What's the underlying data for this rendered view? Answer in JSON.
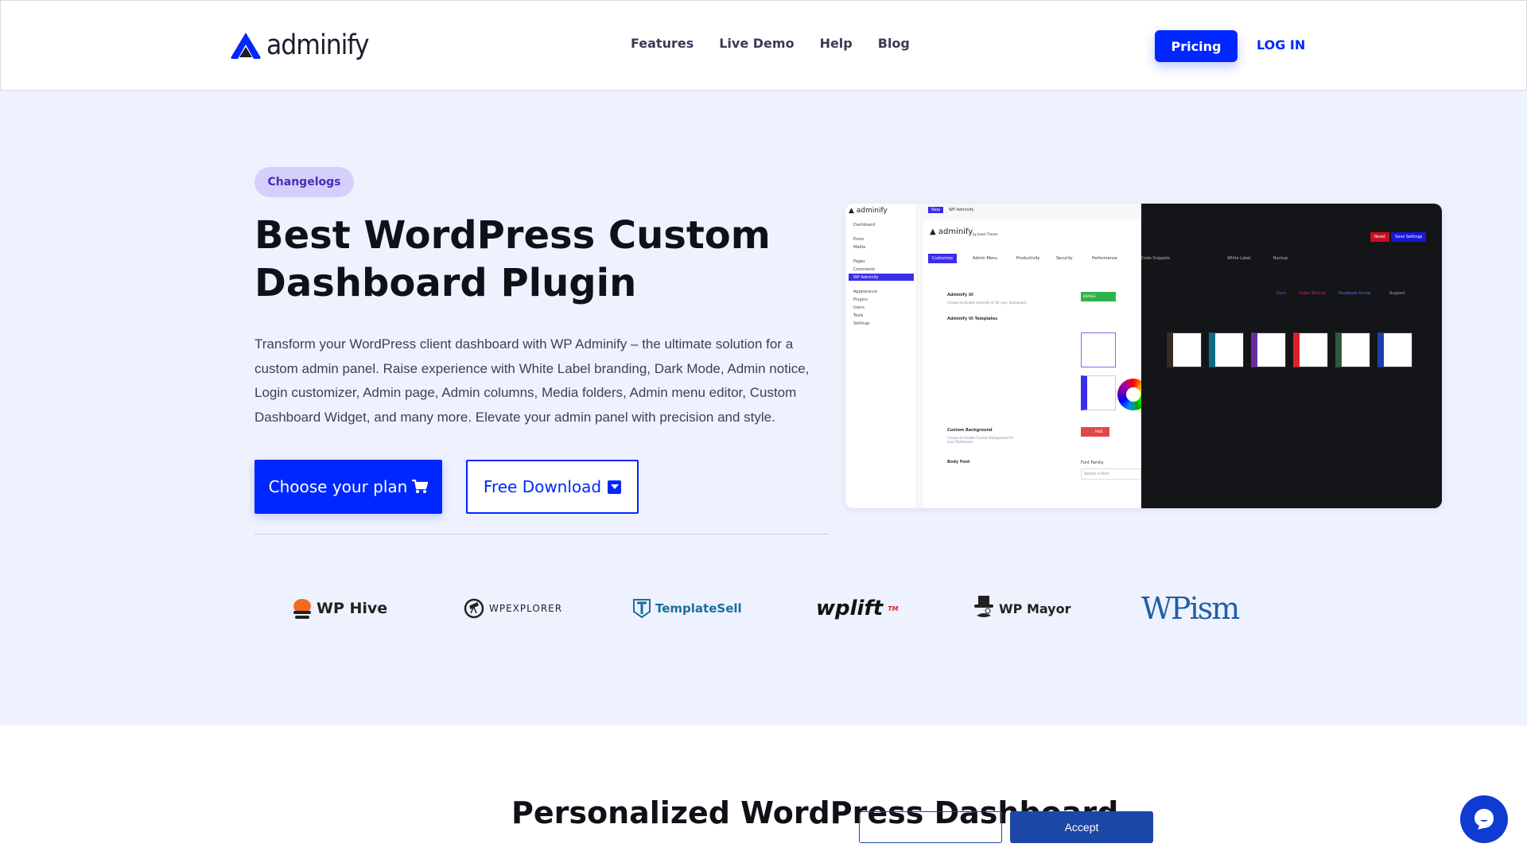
{
  "header": {
    "logo_text": "adminify",
    "nav": [
      "Features",
      "Live Demo",
      "Help",
      "Blog"
    ],
    "pricing_label": "Pricing",
    "login_label": "LOG IN"
  },
  "hero": {
    "badge": "Changelogs",
    "title": "Best WordPress Custom Dashboard Plugin",
    "description": "Transform your WordPress client dashboard with WP Adminify – the ultimate solution for a custom admin panel. Raise experience with White Label branding, Dark Mode, Admin notice, Login customizer, Admin page, Admin columns, Media folders, Admin menu editor, Custom Dashboard Widget, and many more. Elevate your admin panel with precision and style.",
    "primary_button": "Choose your plan",
    "secondary_button": "Free Download",
    "accent_color": "#0027ff"
  },
  "preview": {
    "sidebar": [
      "Dashboard",
      "Posts",
      "Media",
      "Pages",
      "Comments",
      "WP Adminify",
      "Appearance",
      "Plugins",
      "Users",
      "Tools",
      "Settings"
    ],
    "topbar_new": "New",
    "topbar_site": "WP Adminify",
    "brand_by": "by Jewel Theme",
    "tabs": [
      "Customize",
      "Admin Menu",
      "Productivity",
      "Security",
      "Performance",
      "Code Snippets",
      "White Label",
      "Backup"
    ],
    "reset": "Reset",
    "save": "Save Settings",
    "links": [
      "Docs",
      "Video Tutorial",
      "Facebook Group",
      "Support"
    ],
    "ui_label": "Adminify UI",
    "ui_desc": "Choose to Enable Adminify UI for your Dashboard.",
    "ui_toggle": "ENABLE",
    "templates_label": "Adminify UI Templates",
    "bg_label": "Custom Background",
    "bg_desc": "Choose to Enable Custom Background for your Dashboard.",
    "bg_toggle": "HIDE",
    "font_label": "Body Font",
    "font_family_label": "Font Family",
    "font_placeholder": "Select a font",
    "template_colors": [
      "#ffffff",
      "#1b1b3a",
      "#3a2a22",
      "#0f6b82",
      "#6a2ba0",
      "#e0202a",
      "#2f5a3a",
      "#1f3fa8"
    ]
  },
  "partners": [
    "WP Hive",
    "WPEXPLORER",
    "TemplateSell",
    "wplift",
    "WP Mayor",
    "WPism"
  ],
  "section2": {
    "title": "Personalized WordPress Dashboard"
  },
  "cookie": {
    "accept_label": "Accept"
  }
}
